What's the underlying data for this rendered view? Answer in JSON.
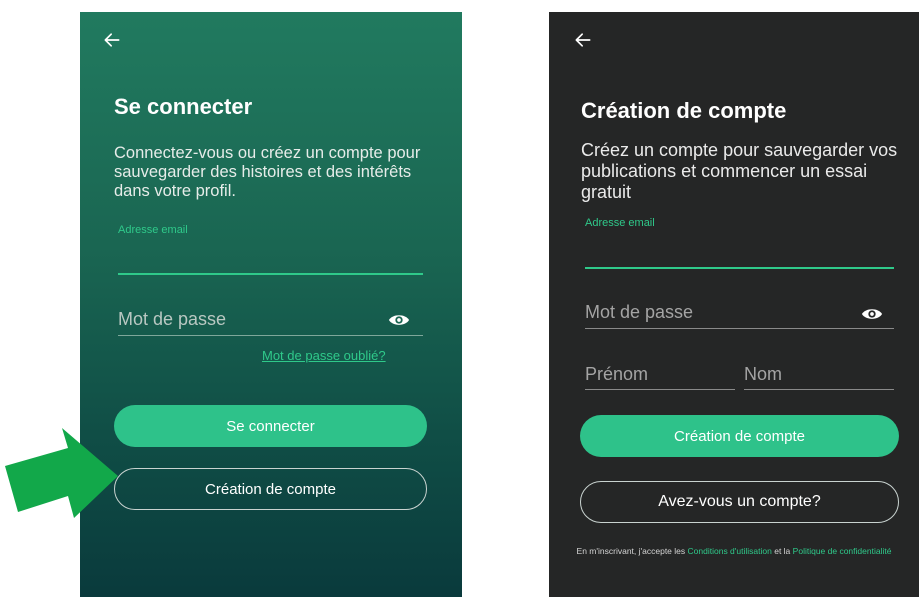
{
  "login_screen": {
    "title": "Se connecter",
    "description": "Connectez-vous ou créez un compte pour sauvegarder des histoires et des intérêts dans votre profil.",
    "email_label": "Adresse email",
    "password_placeholder": "Mot de passe",
    "forgot_password": "Mot de passe oublié?",
    "login_button": "Se connecter",
    "create_account_button": "Création de compte"
  },
  "signup_screen": {
    "title": "Création de compte",
    "description": "Créez un compte pour sauvegarder vos publications et commencer un essai gratuit",
    "email_label": "Adresse email",
    "password_placeholder": "Mot de passe",
    "first_name_placeholder": "Prénom",
    "last_name_placeholder": "Nom",
    "create_account_button": "Création de compte",
    "have_account_button": "Avez-vous un compte?",
    "terms_prefix": "En m'inscrivant, j'accepte les",
    "terms_link": "Conditions d'utilisation",
    "terms_and": "et la",
    "privacy_link": "Politique de confidentialité"
  },
  "colors": {
    "accent": "#2ec28a",
    "login_bg_top": "#217a5f",
    "login_bg_bottom": "#0a3a3c",
    "signup_bg": "#252626",
    "annotation_arrow": "#12a84a"
  },
  "icons": {
    "back": "arrow-left-icon",
    "password_visibility": "eye-icon",
    "annotation": "green-pointer-arrow"
  }
}
